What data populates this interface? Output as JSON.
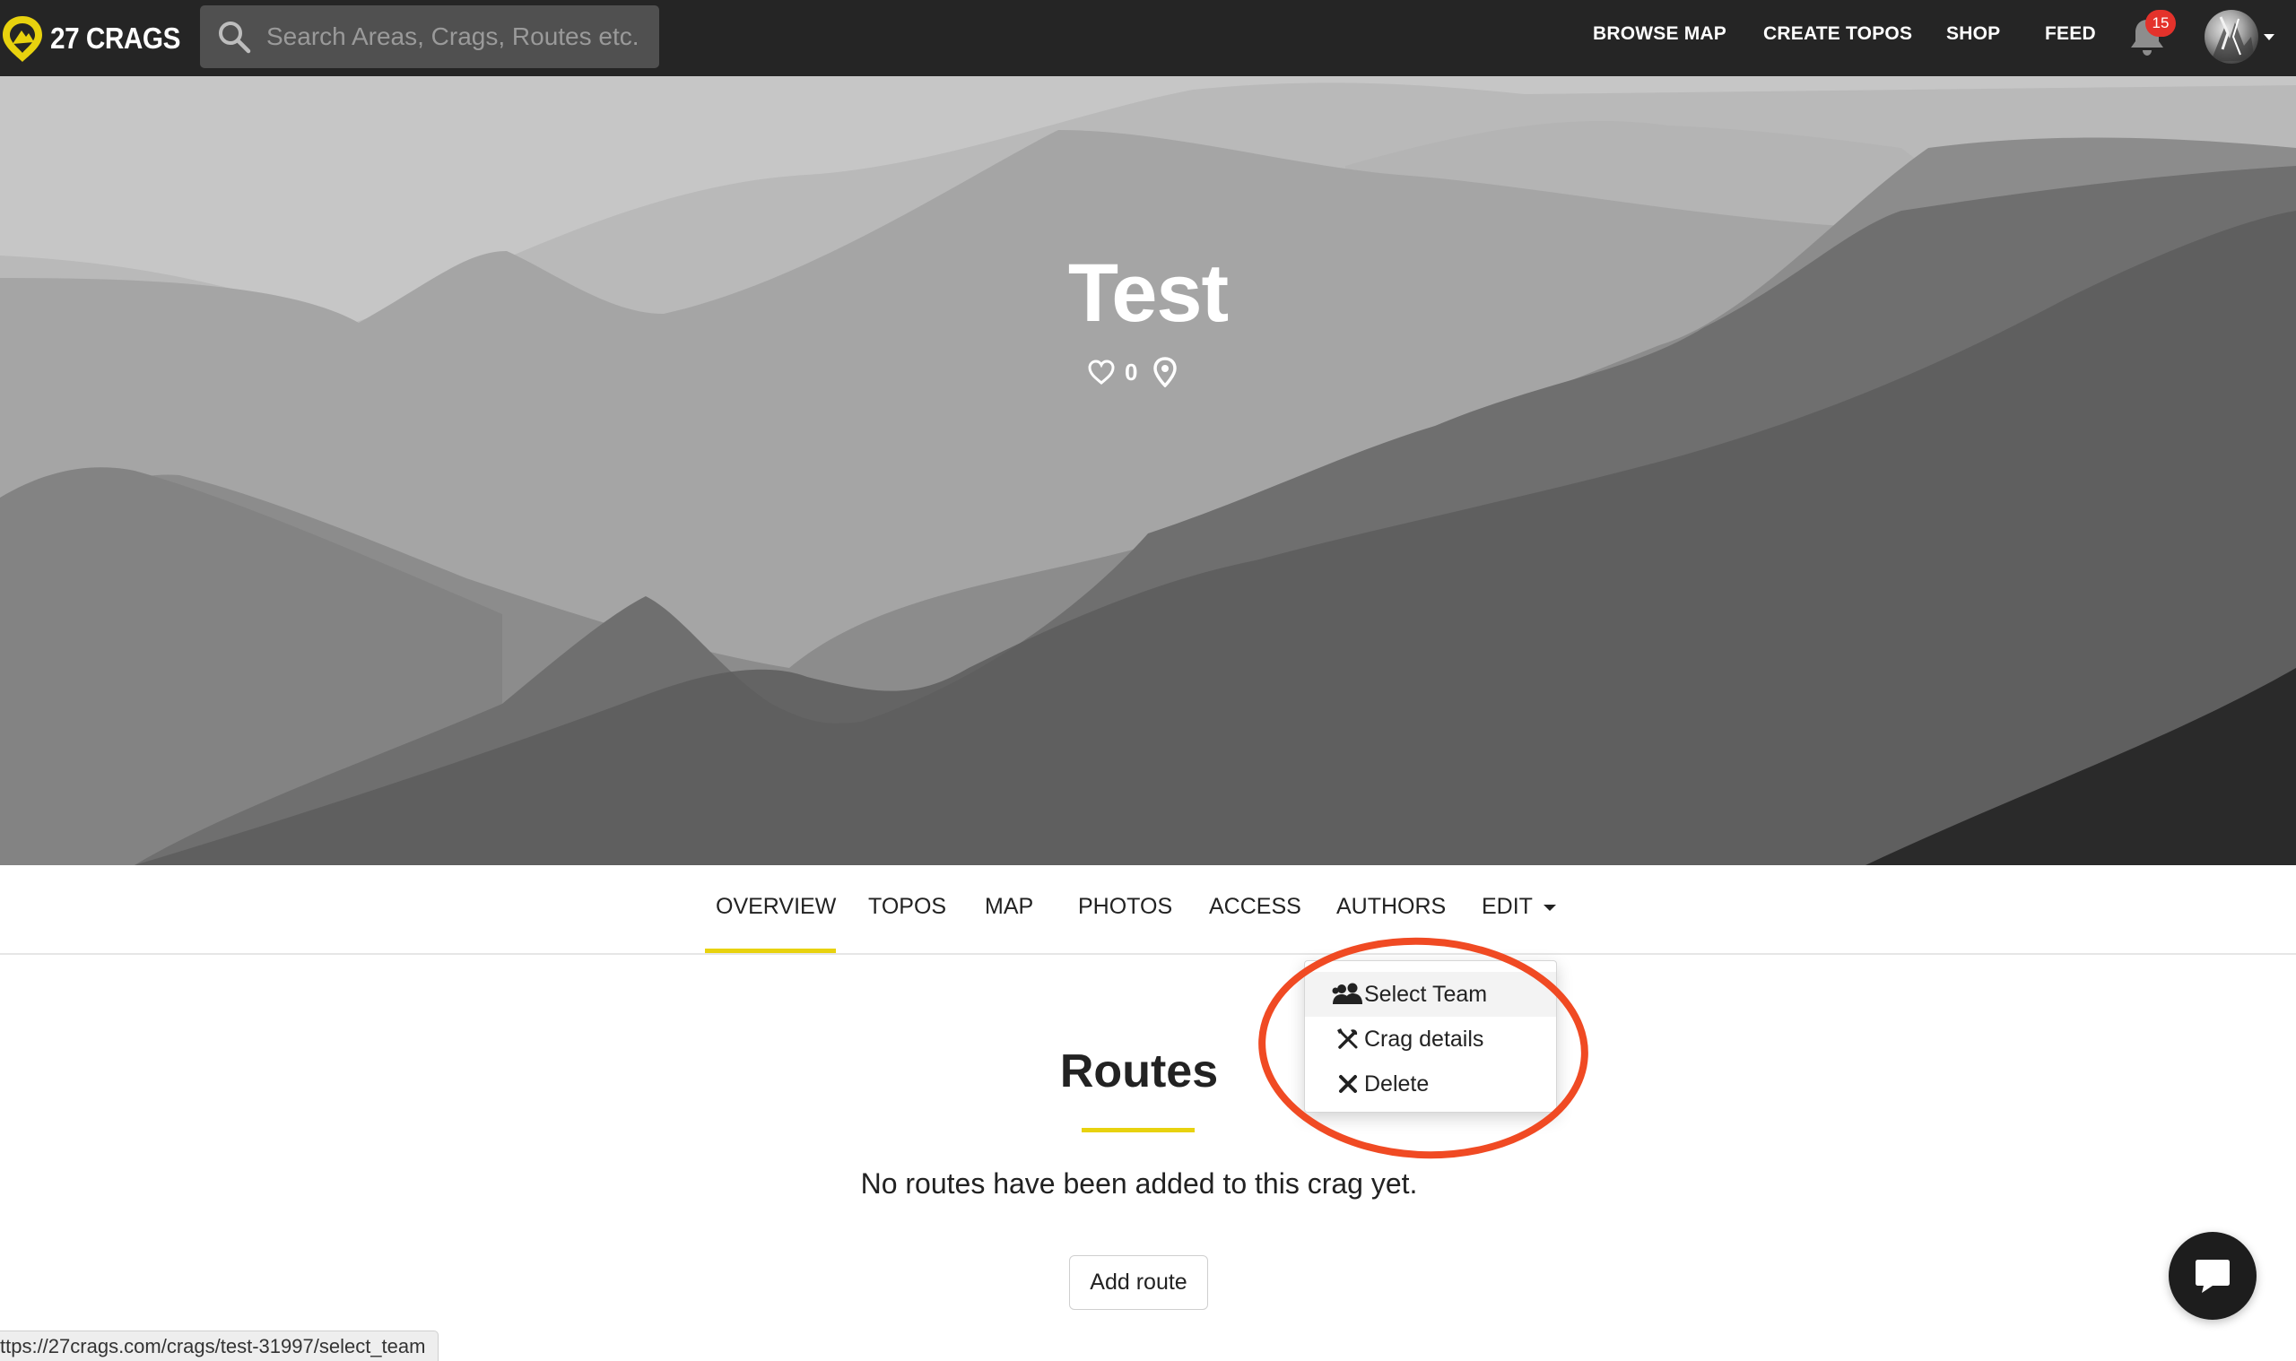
{
  "app": {
    "logo_text": "27 CRAGS",
    "accent_color": "#e8d20e"
  },
  "search": {
    "placeholder": "Search Areas, Crags, Routes etc."
  },
  "nav": {
    "links": [
      "BROWSE MAP",
      "CREATE TOPOS",
      "SHOP",
      "FEED"
    ],
    "notification_count": "15",
    "notification_color": "#e4322b"
  },
  "hero": {
    "title": "Test",
    "likes": "0",
    "icons": [
      "heart-icon",
      "location-pin-icon"
    ]
  },
  "tabs": {
    "items": [
      "OVERVIEW",
      "TOPOS",
      "MAP",
      "PHOTOS",
      "ACCESS",
      "AUTHORS",
      "EDIT"
    ],
    "active": "OVERVIEW"
  },
  "edit_menu": {
    "items": [
      {
        "label": "Select Team",
        "icon": "team-icon",
        "highlighted": true
      },
      {
        "label": "Crag details",
        "icon": "tools-icon",
        "highlighted": false
      },
      {
        "label": "Delete",
        "icon": "close-icon",
        "highlighted": false
      }
    ]
  },
  "annotation": {
    "color": "#f04a23"
  },
  "routes": {
    "title": "Routes",
    "empty_message": "No routes have been added to this crag yet.",
    "add_button": "Add route"
  },
  "status_bar": {
    "url": "ttps://27crags.com/crags/test-31997/select_team"
  }
}
